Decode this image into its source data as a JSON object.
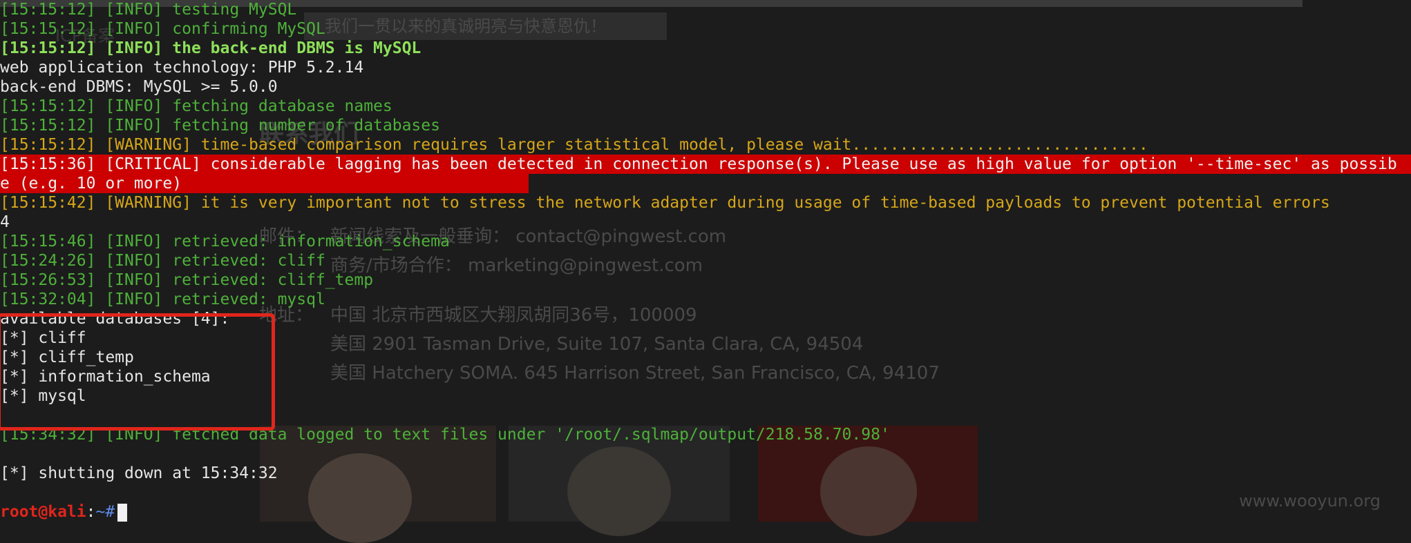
{
  "background_page": {
    "banner": "我们一贯以来的真诚明亮与快意恩仇！",
    "left_hint": "ICP备案",
    "contact_title": "联系我们",
    "email_label": "邮件：",
    "news_line": "新闻线索及一般垂询： contact@pingwest.com",
    "biz_line": "商务/市场合作： marketing@pingwest.com",
    "address_label": "地址：",
    "addr_cn": "中国 北京市西城区大翔凤胡同36号，100009",
    "addr_us1": "美国 2901 Tasman Drive, Suite 107, Santa Clara, CA, 94504",
    "addr_us2": "美国 Hatchery SOMA. 645 Harrison Street, San Francisco, CA, 94107",
    "watermark": "www.wooyun.org"
  },
  "terminal": {
    "l01": "[15:15:12] [INFO] testing MySQL",
    "l02": "[15:15:12] [INFO] confirming MySQL",
    "l03": "[15:15:12] [INFO] the back-end DBMS is MySQL",
    "l04": "web application technology: PHP 5.2.14",
    "l05": "back-end DBMS: MySQL >= 5.0.0",
    "l06": "[15:15:12] [INFO] fetching database names",
    "l07": "[15:15:12] [INFO] fetching number of databases",
    "l08": "[15:15:12] [WARNING] time-based comparison requires larger statistical model, please wait...............................",
    "l09": "[15:15:36] [CRITICAL] considerable lagging has been detected in connection response(s). Please use as high value for option '--time-sec' as possib",
    "l10": "e (e.g. 10 or more)",
    "l11": "[15:15:42] [WARNING] it is very important not to stress the network adapter during usage of time-based payloads to prevent potential errors",
    "l12": "4",
    "l13": "[15:15:46] [INFO] retrieved: information_schema",
    "l14": "[15:24:26] [INFO] retrieved: cliff",
    "l15": "[15:26:53] [INFO] retrieved: cliff_temp",
    "l16": "[15:32:04] [INFO] retrieved: mysql",
    "l17": "available databases [4]:",
    "l18": "[*] cliff",
    "l19": "[*] cliff_temp",
    "l20": "[*] information_schema",
    "l21": "[*] mysql",
    "l22": "[15:34:32] [INFO] fetched data logged to text files under '/root/.sqlmap/output/218.58.70.98'",
    "l23": "[*] shutting down at 15:34:32",
    "prompt_user": "root@kali",
    "prompt_sep": ":",
    "prompt_path": "~#"
  },
  "colors": {
    "info": "#4eb13a",
    "warning": "#d6a619",
    "critical_bg": "#cc0000",
    "highlight_box": "#e0261c"
  }
}
